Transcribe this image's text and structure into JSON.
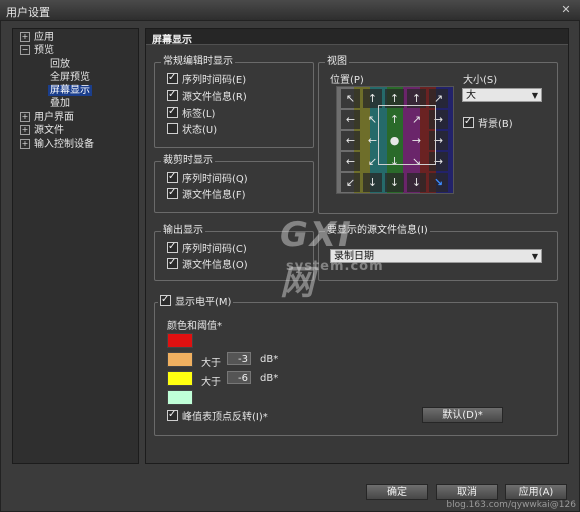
{
  "window": {
    "title": "用户设置",
    "close_glyph": "✕"
  },
  "tree": {
    "items": [
      {
        "label": "应用",
        "expander": "+"
      },
      {
        "label": "预览",
        "expander": "−"
      },
      {
        "label": "回放"
      },
      {
        "label": "全屏预览"
      },
      {
        "label": "屏幕显示",
        "selected": true
      },
      {
        "label": "叠加"
      },
      {
        "label": "用户界面",
        "expander": "+"
      },
      {
        "label": "源文件",
        "expander": "+"
      },
      {
        "label": "输入控制设备",
        "expander": "+"
      }
    ]
  },
  "panel": {
    "header": "屏幕显示"
  },
  "edit_display": {
    "title": "常规编辑时显示",
    "options": [
      {
        "label": "序列时间码(E)",
        "checked": true
      },
      {
        "label": "源文件信息(R)",
        "checked": true
      },
      {
        "label": "标签(L)",
        "checked": true
      },
      {
        "label": "状态(U)",
        "checked": false
      }
    ]
  },
  "trim_display": {
    "title": "裁剪时显示",
    "options": [
      {
        "label": "序列时间码(Q)",
        "checked": true
      },
      {
        "label": "源文件信息(F)",
        "checked": true
      }
    ]
  },
  "output_display": {
    "title": "输出显示",
    "options": [
      {
        "label": "序列时间码(C)",
        "checked": true
      },
      {
        "label": "源文件信息(O)",
        "checked": true
      }
    ]
  },
  "view": {
    "title": "视图",
    "position_label": "位置(P)",
    "size_label": "大小(S)",
    "size_value": "大",
    "background_label": "背景(B)",
    "background_checked": true,
    "bar_colors": [
      "#6e6e6e",
      "#6e6e2a",
      "#256a6a",
      "#2a6a2a",
      "#6a256a",
      "#6a2222",
      "#22226a"
    ],
    "arrows": [
      [
        "↖",
        "↑",
        "↑",
        "↑",
        "↗"
      ],
      [
        "←",
        "↖",
        "↑",
        "↗",
        "→"
      ],
      [
        "←",
        "←",
        "●",
        "→",
        "→"
      ],
      [
        "←",
        "↙",
        "↓",
        "↘",
        "→"
      ],
      [
        "↙",
        "↓",
        "↓",
        "↓",
        "↘"
      ]
    ],
    "active_arrow_color": "#3d8cff"
  },
  "source_info": {
    "title": "要显示的源文件信息(I)",
    "value": "录制日期"
  },
  "level": {
    "title": "显示电平(M)",
    "checked": true,
    "color_threshold_label": "颜色和阈值*",
    "rows": [
      {
        "color": "#e01010"
      },
      {
        "color": "#f0b060",
        "prefix": "大于",
        "value": "-3",
        "unit": "dB*"
      },
      {
        "color": "#ffff10",
        "prefix": "大于",
        "value": "-6",
        "unit": "dB*"
      },
      {
        "color": "#c0ffd8"
      }
    ],
    "peak_reverse_label": "峰值表顶点反转(I)*",
    "peak_reverse_checked": true,
    "default_button": "默认(D)*"
  },
  "footer": {
    "ok": "确定",
    "cancel": "取消",
    "apply": "应用(A)"
  },
  "watermark": "blog.163.com/qywwkai@126",
  "logo": {
    "big": "GXI网",
    "small": "system.com"
  }
}
